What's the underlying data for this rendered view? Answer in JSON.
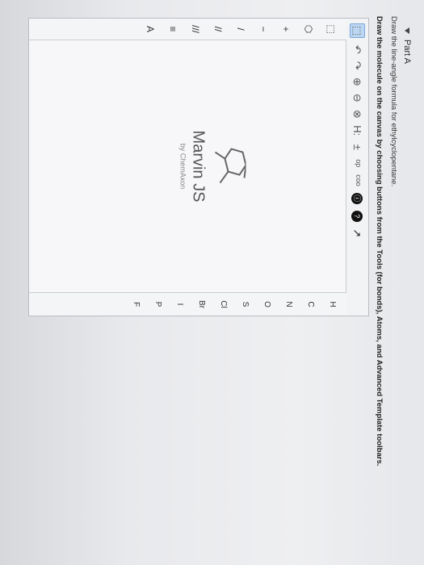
{
  "part": {
    "title": "Part A"
  },
  "question": "Draw the line-angle formula for ethylcyclopentane.",
  "instruction": "Draw the molecule on the canvas by choosing buttons from the Tools (for bonds), Atoms, and Advanced Template toolbars.",
  "toolbar": {
    "items": [
      "⬚",
      "↶",
      "↷",
      "⊕",
      "⊖",
      "⊗",
      "H:",
      "±",
      "ᵒᵖ",
      "ᶜᵒᵒ",
      "ⓘ",
      "?",
      "↗"
    ]
  },
  "left_tools": [
    "⬚",
    "⬡",
    "+",
    "−",
    "/",
    "//",
    "///",
    "≡",
    "A"
  ],
  "atoms": [
    "H",
    "C",
    "N",
    "O",
    "S",
    "Cl",
    "Br",
    "I",
    "P",
    "F"
  ],
  "logo": {
    "title": "Marvin JS",
    "sub": "by ChemAxon"
  }
}
